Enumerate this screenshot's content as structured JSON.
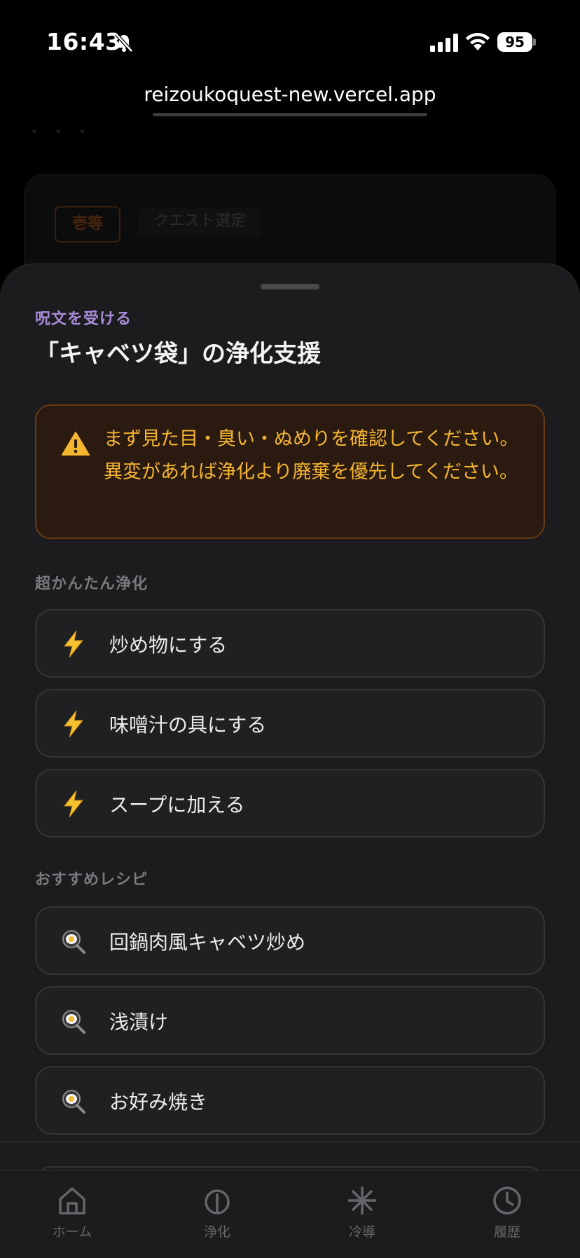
{
  "status_bar": {
    "time": "16:43",
    "battery": "95"
  },
  "browser": {
    "url": "reizoukoquest-new.vercel.app"
  },
  "background": {
    "rank_badge": "壱等",
    "tag": "クエスト選定"
  },
  "sheet": {
    "subtitle": "呪文を受ける",
    "title": "「キャベツ袋」の浄化支援",
    "warning": "まず見た目・臭い・ぬめりを確認してください。異変があれば浄化より廃棄を優先してください。",
    "quick_section": {
      "label": "超かんたん浄化",
      "items": [
        {
          "label": "炒め物にする",
          "icon": "lightning-icon"
        },
        {
          "label": "味噌汁の具にする",
          "icon": "lightning-icon"
        },
        {
          "label": "スープに加える",
          "icon": "lightning-icon"
        }
      ]
    },
    "recipe_section": {
      "label": "おすすめレシピ",
      "items": [
        {
          "label": "回鍋肉風キャベツ炒め",
          "icon": "frying-pan-icon"
        },
        {
          "label": "浅漬け",
          "icon": "frying-pan-icon"
        },
        {
          "label": "お好み焼き",
          "icon": "frying-pan-icon"
        }
      ]
    }
  },
  "tabbar": {
    "items": [
      {
        "label": "ホーム",
        "icon": "home-icon"
      },
      {
        "label": "浄化",
        "icon": "purify-icon"
      },
      {
        "label": "冷導",
        "icon": "snowflake-icon"
      },
      {
        "label": "履歴",
        "icon": "clock-icon"
      }
    ]
  },
  "colors": {
    "accent_purple": "#a98bd8",
    "warning_text": "#f5b530",
    "warning_bg": "#2a1a10",
    "sheet_bg": "#1c1c1e"
  }
}
